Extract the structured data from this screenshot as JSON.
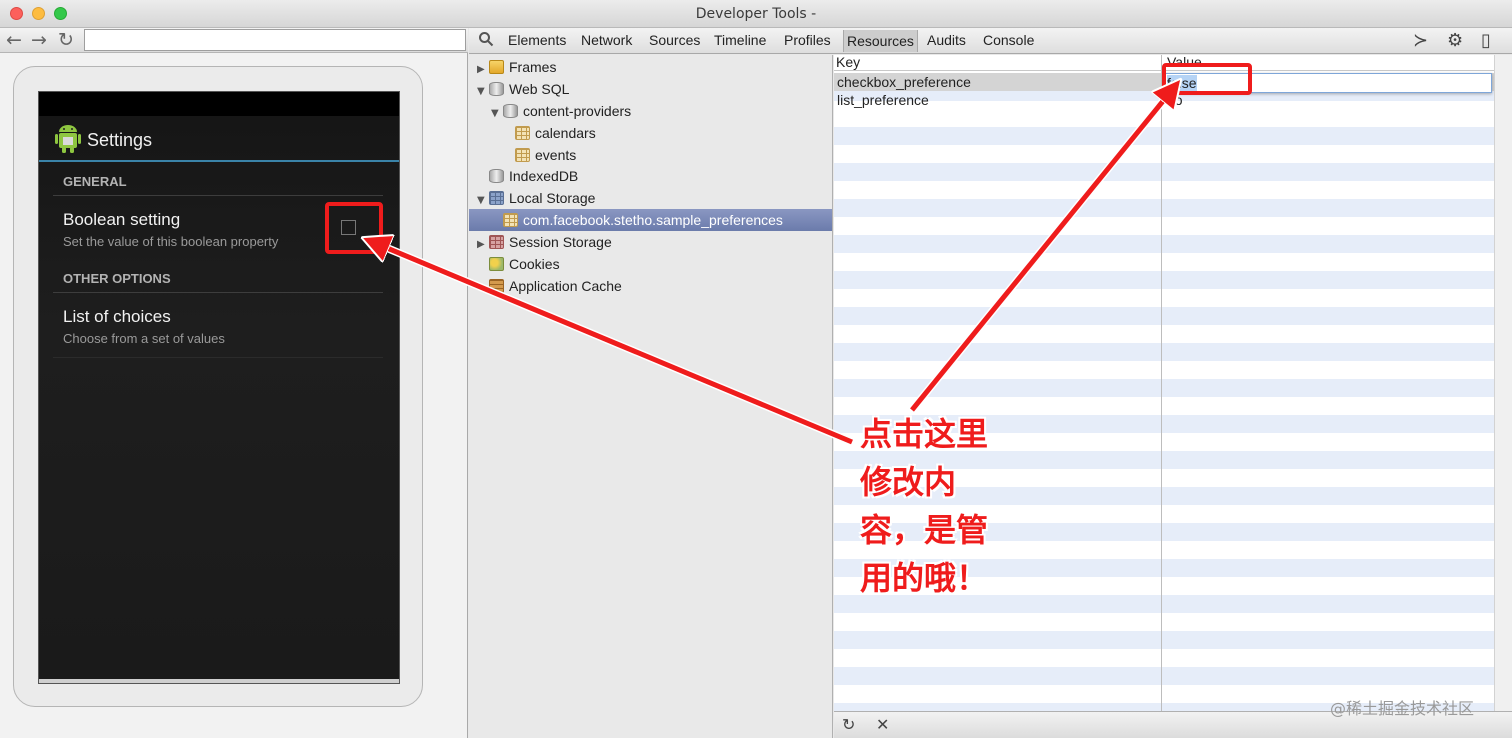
{
  "window": {
    "title": "Developer Tools -"
  },
  "device": {
    "app_title": "Settings",
    "categories": [
      "GENERAL",
      "OTHER OPTIONS"
    ],
    "prefs": [
      {
        "title": "Boolean setting",
        "summary": "Set the value of this boolean property",
        "checked": false
      },
      {
        "title": "List of choices",
        "summary": "Choose from a set of values"
      }
    ]
  },
  "toolbar": {
    "tabs": [
      "Elements",
      "Network",
      "Sources",
      "Timeline",
      "Profiles",
      "Resources",
      "Audits",
      "Console"
    ],
    "active_tab": "Resources"
  },
  "sidebar": {
    "items": [
      {
        "label": "Frames",
        "icon": "folder-icon"
      },
      {
        "label": "Web SQL",
        "icon": "database-icon"
      },
      {
        "label": "content-providers",
        "icon": "database-icon"
      },
      {
        "label": "calendars",
        "icon": "table-icon"
      },
      {
        "label": "events",
        "icon": "table-icon"
      },
      {
        "label": "IndexedDB",
        "icon": "database-icon"
      },
      {
        "label": "Local Storage",
        "icon": "local-storage-icon"
      },
      {
        "label": "com.facebook.stetho.sample_preferences",
        "icon": "table-icon"
      },
      {
        "label": "Session Storage",
        "icon": "session-storage-icon"
      },
      {
        "label": "Cookies",
        "icon": "cookie-icon"
      },
      {
        "label": "Application Cache",
        "icon": "cache-icon"
      }
    ],
    "selected": "com.facebook.stetho.sample_preferences"
  },
  "grid": {
    "headers": {
      "key": "Key",
      "value": "Value"
    },
    "rows": [
      {
        "key": "checkbox_preference",
        "value": "false"
      },
      {
        "key": "list_preference",
        "value": "uo"
      }
    ],
    "editing_value": "false"
  },
  "annotation": {
    "lines": [
      "点击这里",
      "修改内",
      "容，是管",
      "用的哦！"
    ],
    "color": "#ef1c1c"
  },
  "watermark": "@稀土掘金技术社区"
}
